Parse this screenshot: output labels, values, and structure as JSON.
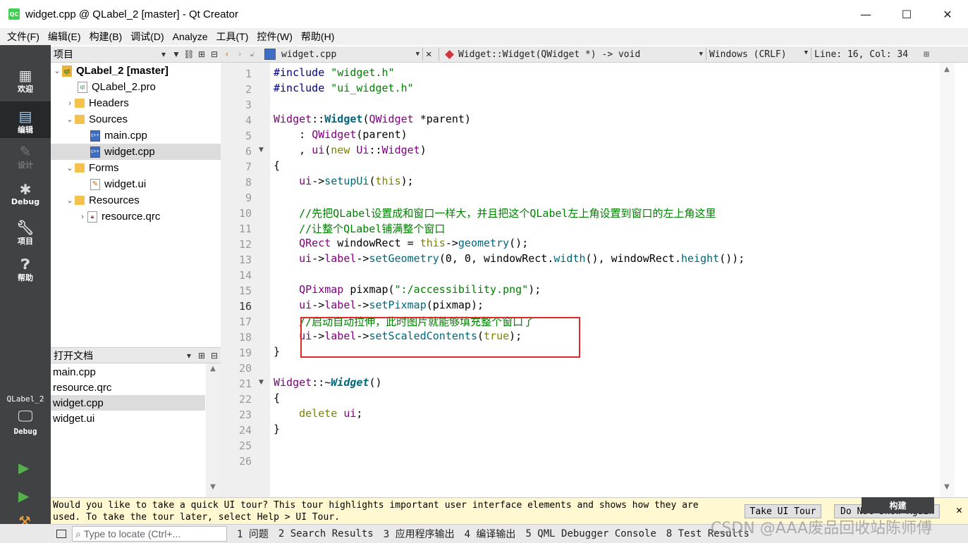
{
  "window": {
    "title": "widget.cpp @ QLabel_2 [master] - Qt Creator",
    "logo": "QC",
    "minimize": "—",
    "maximize": "☐",
    "close": "✕"
  },
  "menu": [
    "文件(F)",
    "编辑(E)",
    "构建(B)",
    "调试(D)",
    "Analyze",
    "工具(T)",
    "控件(W)",
    "帮助(H)"
  ],
  "modes": [
    {
      "label": "欢迎",
      "icon": "grid-icon"
    },
    {
      "label": "编辑",
      "icon": "edit-icon"
    },
    {
      "label": "设计",
      "icon": "design-icon"
    },
    {
      "label": "Debug",
      "icon": "bug-icon"
    },
    {
      "label": "项目",
      "icon": "wrench-icon"
    },
    {
      "label": "帮助",
      "icon": "help-icon"
    }
  ],
  "kit": {
    "name": "QLabel_2",
    "mode": "Debug"
  },
  "project_panel": {
    "title": "项目",
    "tree": [
      {
        "label": "QLabel_2 [master]",
        "type": "project",
        "depth": 0,
        "expanded": true
      },
      {
        "label": "QLabel_2.pro",
        "type": "pro",
        "depth": 1
      },
      {
        "label": "Headers",
        "type": "folder",
        "depth": 1,
        "expanded": false
      },
      {
        "label": "Sources",
        "type": "folder",
        "depth": 1,
        "expanded": true
      },
      {
        "label": "main.cpp",
        "type": "cpp",
        "depth": 2
      },
      {
        "label": "widget.cpp",
        "type": "cpp",
        "depth": 2,
        "selected": true
      },
      {
        "label": "Forms",
        "type": "folder",
        "depth": 1,
        "expanded": true
      },
      {
        "label": "widget.ui",
        "type": "ui",
        "depth": 2
      },
      {
        "label": "Resources",
        "type": "folder",
        "depth": 1,
        "expanded": true
      },
      {
        "label": "resource.qrc",
        "type": "qrc",
        "depth": 2,
        "expanded": false
      }
    ]
  },
  "open_docs": {
    "title": "打开文档",
    "items": [
      "main.cpp",
      "resource.qrc",
      "widget.cpp",
      "widget.ui"
    ],
    "selected": 2
  },
  "editor_toolbar": {
    "file": "widget.cpp",
    "function": "Widget::Widget(QWidget *) -> void",
    "line_ending": "Windows (CRLF)",
    "position": "Line: 16, Col: 34"
  },
  "code_lines": [
    "#include \"widget.h\"",
    "#include \"ui_widget.h\"",
    "",
    "Widget::Widget(QWidget *parent)",
    "    : QWidget(parent)",
    "    , ui(new Ui::Widget)",
    "{",
    "    ui->setupUi(this);",
    "",
    "    //先把QLabel设置成和窗口一样大，并且把这个QLabel左上角设置到窗口的左上角这里",
    "    //让整个QLabel铺满整个窗口",
    "    QRect windowRect = this->geometry();",
    "    ui->label->setGeometry(0, 0, windowRect.width(), windowRect.height());",
    "",
    "    QPixmap pixmap(\":/accessibility.png\");",
    "    ui->label->setPixmap(pixmap);",
    "    //启动自动拉伸，此时图片就能够填充整个窗口了",
    "    ui->label->setScaledContents(true);",
    "}",
    "",
    "Widget::~Widget()",
    "{",
    "    delete ui;",
    "}",
    "",
    ""
  ],
  "current_line": 16,
  "tour": {
    "text": "Would you like to take a quick UI tour? This tour highlights important user interface elements and shows how they are used. To take the tour later, select Help > UI Tour.",
    "take_button": "Take UI Tour",
    "dont_button": "Do Not Show Again"
  },
  "build_tooltip": "构建",
  "statusbar": {
    "locator_placeholder": "Type to locate (Ctrl+...",
    "panes": [
      "1 问题",
      "2 Search Results",
      "3 应用程序输出",
      "4 编译输出",
      "5 QML Debugger Console",
      "8 Test Results"
    ]
  },
  "watermark": "CSDN @AAA废品回收站陈师傅"
}
